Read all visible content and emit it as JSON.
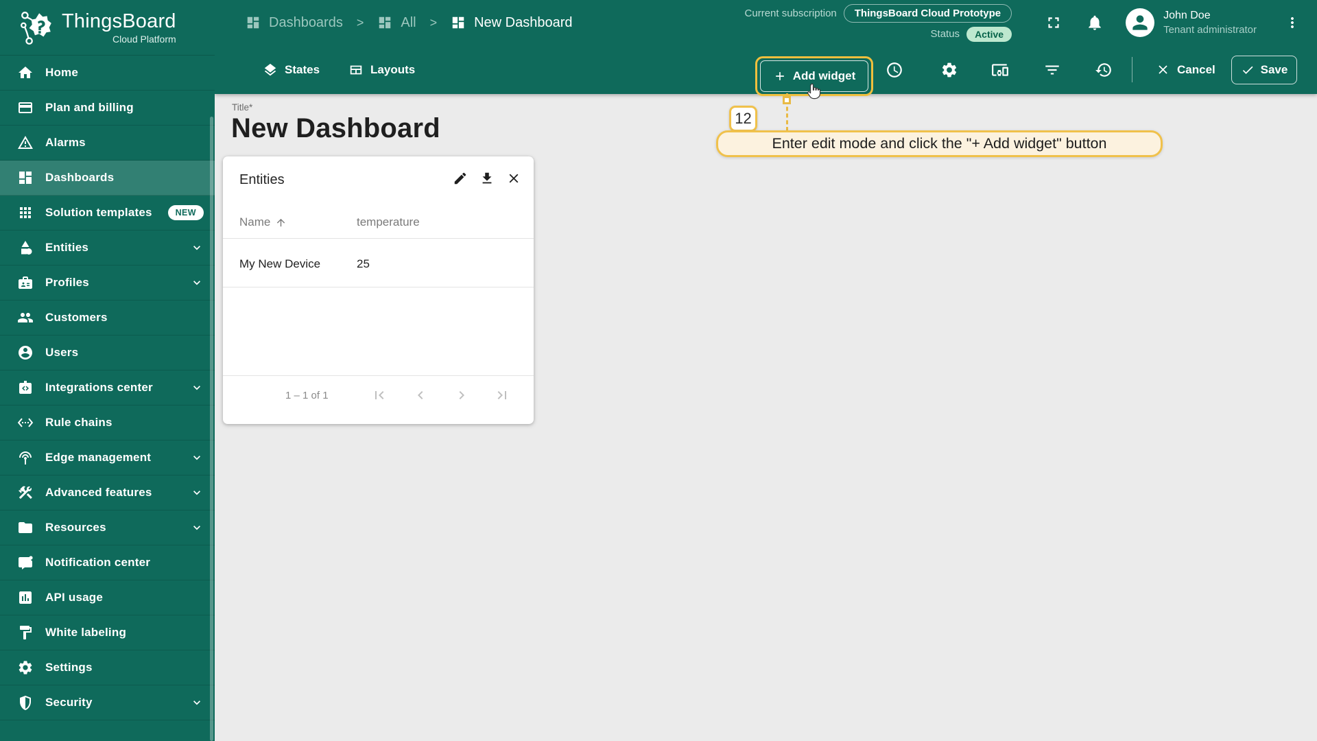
{
  "colors": {
    "primary_green": "#0F6A5B",
    "active_item_overlay": "rgba(255,255,255,0.15)",
    "content_background": "#EBEBEB",
    "tour_highlight": "#F0C14B",
    "status_active_bg": "#BDE8CF",
    "status_active_text": "#07634A"
  },
  "header": {
    "logo_title": "ThingsBoard",
    "logo_subtitle": "Cloud Platform",
    "breadcrumb_separator": ">",
    "breadcrumbs": [
      {
        "label": "Dashboards"
      },
      {
        "label": "All"
      },
      {
        "label": "New Dashboard"
      }
    ],
    "subscription_label": "Current subscription",
    "subscription_value": "ThingsBoard Cloud Prototype",
    "status_label": "Status",
    "status_value": "Active",
    "user_name": "John Doe",
    "user_role": "Tenant administrator"
  },
  "sidebar": {
    "items": [
      {
        "label": "Home"
      },
      {
        "label": "Plan and billing"
      },
      {
        "label": "Alarms"
      },
      {
        "label": "Dashboards",
        "active": true
      },
      {
        "label": "Solution templates",
        "badge": "NEW"
      },
      {
        "label": "Entities",
        "expandable": true
      },
      {
        "label": "Profiles",
        "expandable": true
      },
      {
        "label": "Customers"
      },
      {
        "label": "Users"
      },
      {
        "label": "Integrations center",
        "expandable": true
      },
      {
        "label": "Rule chains"
      },
      {
        "label": "Edge management",
        "expandable": true
      },
      {
        "label": "Advanced features",
        "expandable": true
      },
      {
        "label": "Resources",
        "expandable": true
      },
      {
        "label": "Notification center"
      },
      {
        "label": "API usage"
      },
      {
        "label": "White labeling"
      },
      {
        "label": "Settings"
      },
      {
        "label": "Security",
        "expandable": true
      }
    ]
  },
  "toolbar": {
    "states_tab": "States",
    "layouts_tab": "Layouts",
    "add_widget_label": "Add widget",
    "cancel_label": "Cancel",
    "save_label": "Save"
  },
  "main": {
    "title_label": "Title*",
    "title_value": "New Dashboard"
  },
  "widget": {
    "title": "Entities",
    "table": {
      "columns": [
        "Name",
        "temperature"
      ],
      "rows": [
        [
          "My New Device",
          "25"
        ]
      ]
    },
    "pagination": {
      "range_label": "1 – 1 of 1"
    }
  },
  "annotation": {
    "step_number": "12",
    "tooltip_text": "Enter edit mode and click the \"+ Add widget\" button"
  }
}
